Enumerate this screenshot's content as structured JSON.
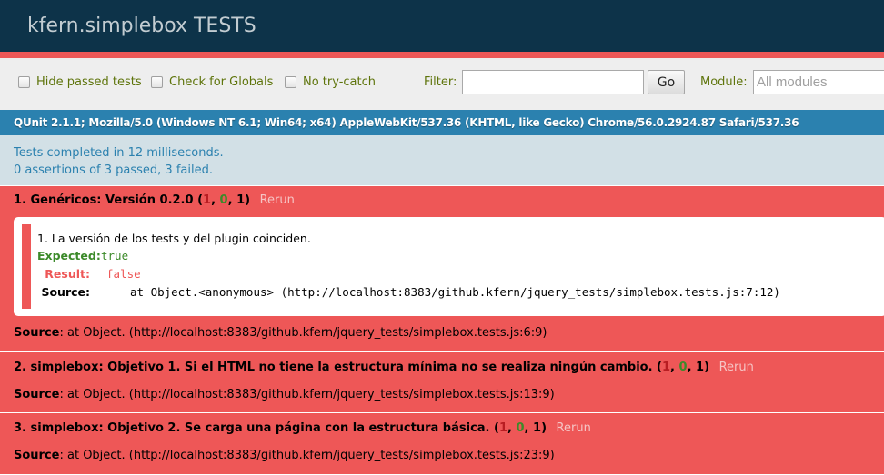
{
  "header": {
    "title": "kfern.simplebox TESTS"
  },
  "toolbar": {
    "hide_passed_label": "Hide passed tests",
    "check_globals_label": "Check for Globals",
    "no_try_catch_label": "No try-catch",
    "filter_label": "Filter:",
    "filter_value": "",
    "go_label": "Go",
    "module_label": "Module:",
    "module_placeholder": "All modules"
  },
  "user_agent": "QUnit 2.1.1; Mozilla/5.0 (Windows NT 6.1; Win64; x64) AppleWebKit/537.36 (KHTML, like Gecko) Chrome/56.0.2924.87 Safari/537.36",
  "results": {
    "line1": "Tests completed in 12 milliseconds.",
    "line2": "0 assertions of 3 passed, 3 failed."
  },
  "tests": [
    {
      "name": "1. Genéricos: Versión 0.2.0",
      "failed": "1",
      "passed": "0",
      "total": "1",
      "rerun": "Rerun",
      "assertion": {
        "message": "1. La versión de los tests y del plugin coinciden.",
        "expected_label": "Expected:",
        "expected": "true",
        "result_label": "Result:",
        "result": "false",
        "source_label": "Source:",
        "source": "at Object.<anonymous> (http://localhost:8383/github.kfern/jquery_tests/simplebox.tests.js:7:12)"
      },
      "source_label": "Source",
      "source": ": at Object. (http://localhost:8383/github.kfern/jquery_tests/simplebox.tests.js:6:9)"
    },
    {
      "name": "2. simplebox: Objetivo 1. Si el HTML no tiene la estructura mínima no se realiza ningún cambio.",
      "failed": "1",
      "passed": "0",
      "total": "1",
      "rerun": "Rerun",
      "source_label": "Source",
      "source": ": at Object. (http://localhost:8383/github.kfern/jquery_tests/simplebox.tests.js:13:9)"
    },
    {
      "name": "3. simplebox: Objetivo 2. Se carga una página con la estructura básica.",
      "failed": "1",
      "passed": "0",
      "total": "1",
      "rerun": "Rerun",
      "source_label": "Source",
      "source": ": at Object. (http://localhost:8383/github.kfern/jquery_tests/simplebox.tests.js:23:9)"
    }
  ],
  "colors": {
    "header_bg": "#0d3349",
    "fail_bg": "#ee5757",
    "ua_bg": "#2b81af",
    "results_bg": "#d2e0e6",
    "toolbar_label": "#5e740b"
  }
}
